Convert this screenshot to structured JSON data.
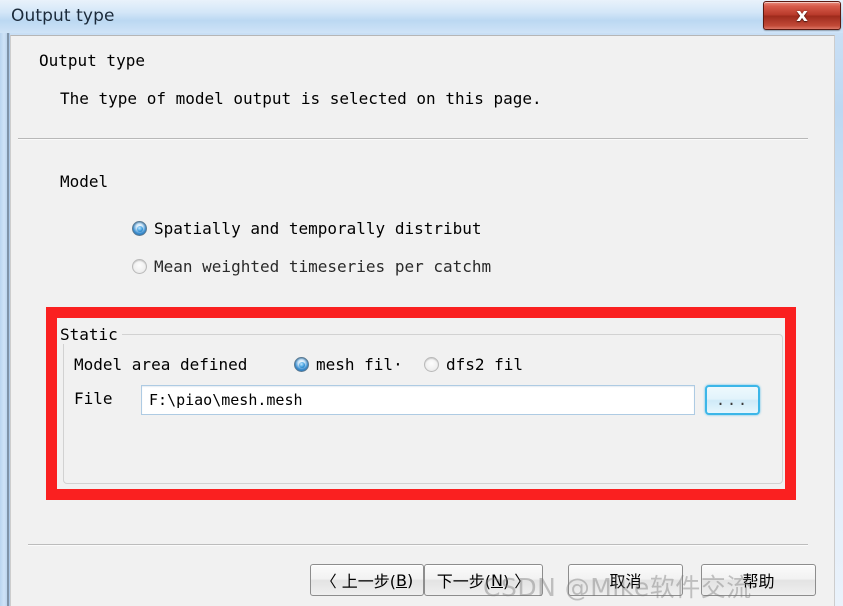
{
  "window": {
    "title": "Output type",
    "close_label": "x",
    "close_icon": "close-icon"
  },
  "header": {
    "title": "Output type",
    "description": "The type of model output is selected on this page."
  },
  "model_section": {
    "label": "Model",
    "options": [
      {
        "label": "Spatially and temporally distribut",
        "selected": true
      },
      {
        "label": "Mean weighted timeseries per catchm",
        "selected": false
      }
    ]
  },
  "static_group": {
    "legend": "Static",
    "area_label": "Model area defined",
    "area_options": [
      {
        "label": "mesh fil·",
        "selected": true
      },
      {
        "label": "dfs2 fil",
        "selected": false
      }
    ],
    "file_label": "File",
    "file_value": "F:\\piao\\mesh.mesh",
    "file_placeholder": "",
    "browse_label": "..."
  },
  "annotation": {
    "color": "#fa2020"
  },
  "footer": {
    "back_prefix": "〈 上一步(",
    "back_accel": "B",
    "back_suffix": ")",
    "next_prefix": "下一步(",
    "next_accel": "N",
    "next_suffix": ") 〉",
    "cancel_label": "取消",
    "help_label": "帮助"
  },
  "watermark": {
    "text": "CSDN @Mike软件交流"
  }
}
